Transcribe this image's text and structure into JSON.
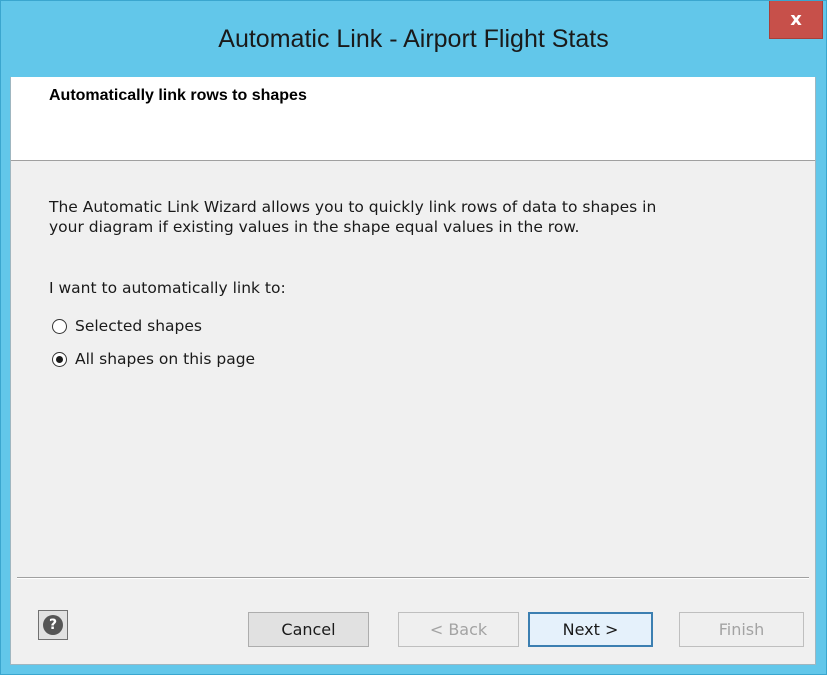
{
  "window": {
    "title": "Automatic Link - Airport Flight Stats",
    "close_label": "x"
  },
  "header": {
    "title": "Automatically link rows to shapes"
  },
  "content": {
    "description_line1": "The Automatic Link Wizard allows you to quickly link rows of data to shapes in",
    "description_line2": "your diagram if existing values in the shape equal values in the row.",
    "prompt": "I want to automatically link to:",
    "options": [
      {
        "label": "Selected shapes",
        "selected": false
      },
      {
        "label": "All shapes on this page",
        "selected": true
      }
    ]
  },
  "footer": {
    "help_label": "?",
    "cancel_label": "Cancel",
    "back_label": "< Back",
    "next_label": "Next >",
    "finish_label": "Finish"
  },
  "colors": {
    "title_bar": "#62c7ea",
    "close_button": "#c7504a",
    "dialog_background": "#f0f0f0"
  }
}
